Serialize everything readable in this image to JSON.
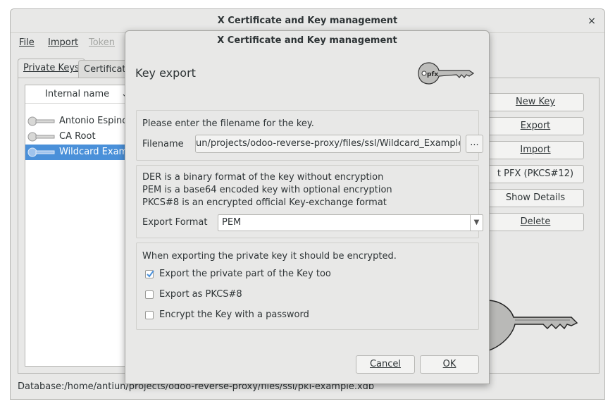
{
  "main_window": {
    "title": "X Certificate and Key management",
    "close_glyph": "×",
    "menu": [
      {
        "label": "File",
        "enabled": true
      },
      {
        "label": "Import",
        "enabled": true
      },
      {
        "label": "Token",
        "enabled": false
      }
    ],
    "tabs": [
      "Private Keys",
      "Certificate"
    ],
    "key_list": {
      "column_header": "Internal name",
      "rows": [
        "Antonio Espinos",
        "CA Root",
        "Wildcard Examp"
      ],
      "selected_index": 2
    },
    "side_buttons": [
      "New Key",
      "Export",
      "Import",
      "t PFX (PKCS#12)",
      "Show Details",
      "Delete"
    ],
    "status": "Database:/home/antiun/projects/odoo-reverse-proxy/files/ssl/pki-example.xdb"
  },
  "dialog": {
    "title": "X Certificate and Key management",
    "heading": "Key export",
    "filename_prompt": "Please enter the filename for the key.",
    "filename_label": "Filename",
    "filename_value": "un/projects/odoo-reverse-proxy/files/ssl/Wildcard_Example.pem",
    "browse_label": "...",
    "format_info": [
      "DER is a binary format of the key without encryption",
      "PEM is a base64 encoded key with optional encryption",
      "PKCS#8 is an encrypted official Key-exchange format"
    ],
    "format_label": "Export Format",
    "format_value": "PEM",
    "encrypt_note": "When exporting the private key it should be encrypted.",
    "checkboxes": [
      {
        "label": "Export the private part of the Key too",
        "checked": true
      },
      {
        "label": "Export as PKCS#8",
        "checked": false
      },
      {
        "label": "Encrypt the Key with a password",
        "checked": false
      }
    ],
    "cancel_label": "Cancel",
    "ok_label": "OK"
  },
  "colors": {
    "selection": "#4a90d9",
    "check": "#4a90d9",
    "window_bg": "#e8e8e7"
  }
}
